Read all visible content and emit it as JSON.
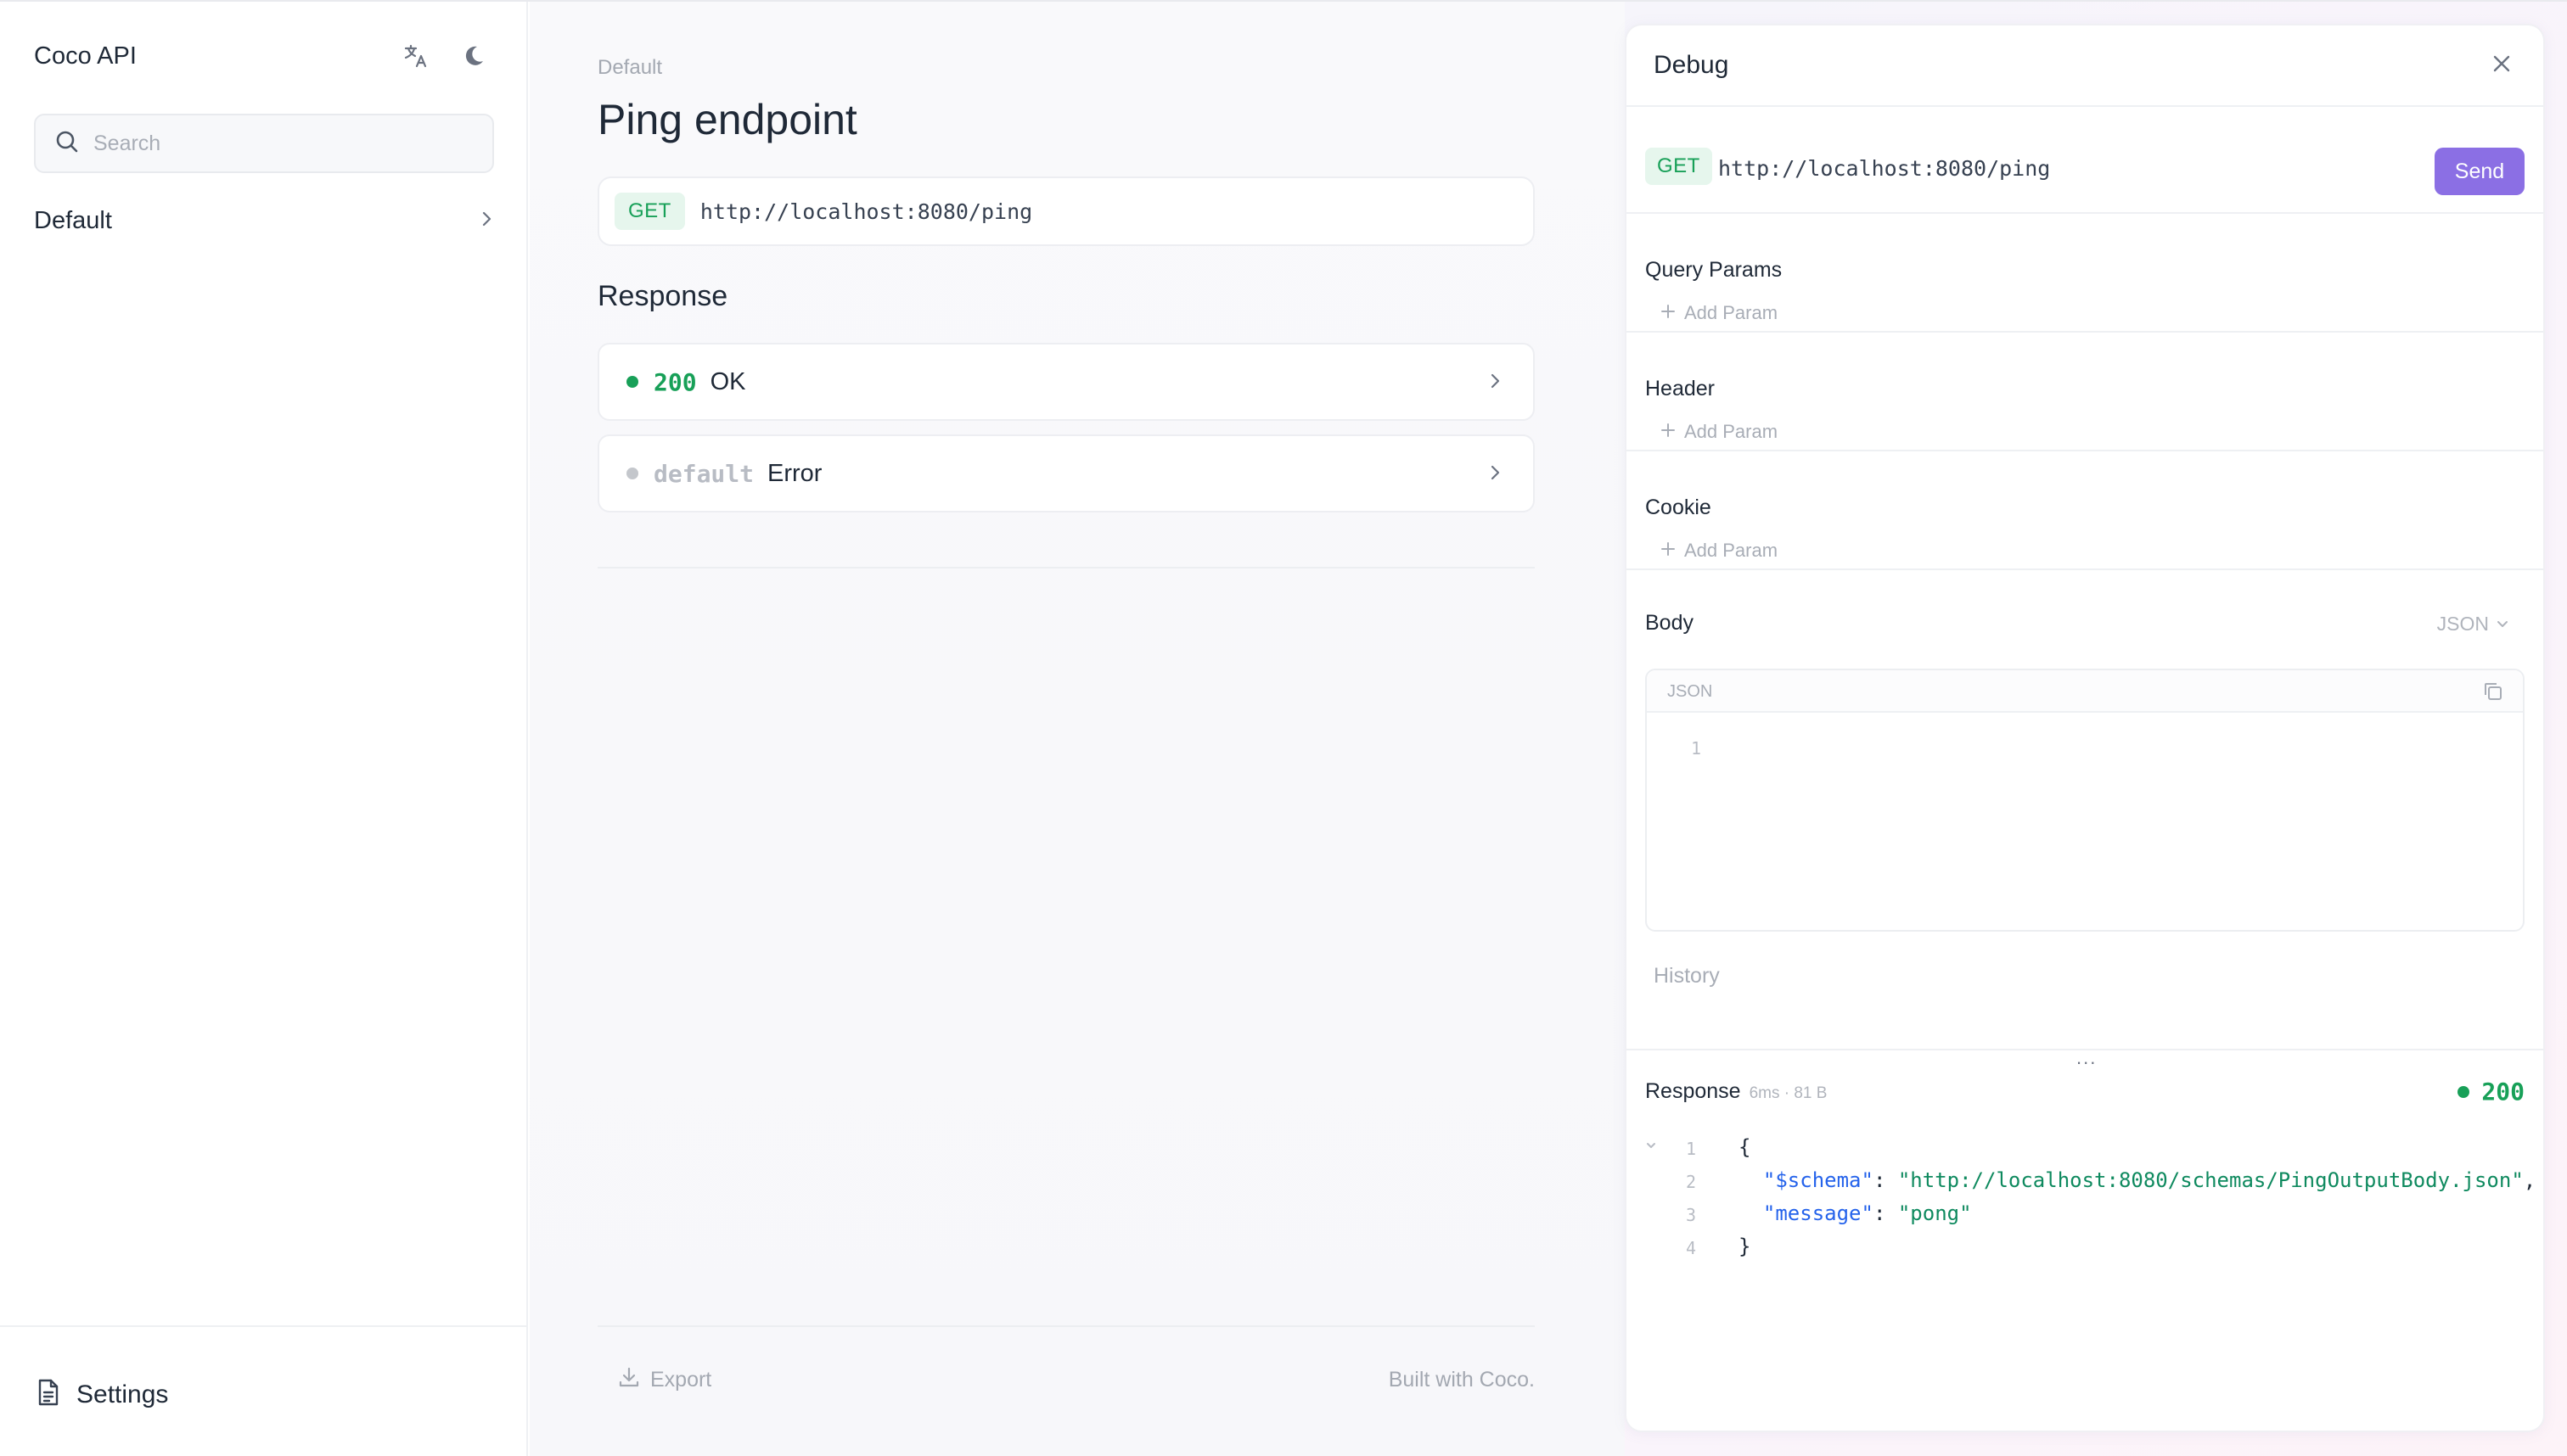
{
  "app": {
    "title": "Coco API"
  },
  "sidebar": {
    "search_placeholder": "Search",
    "items": [
      {
        "label": "Default"
      }
    ],
    "footer": {
      "settings_label": "Settings"
    },
    "icons": {
      "translate": "translate-icon",
      "theme": "moon-icon",
      "search": "search-icon",
      "settings": "document-icon",
      "chevron": "chevron-right-icon"
    }
  },
  "main": {
    "breadcrumb": "Default",
    "title": "Ping endpoint",
    "endpoint": {
      "method": "GET",
      "url": "http://localhost:8080/ping"
    },
    "responses_title": "Response",
    "responses": [
      {
        "code": "200",
        "text": "OK",
        "color": "#18a058",
        "dot": "#18a058"
      },
      {
        "code": "default",
        "text": "Error",
        "color": "#b8bcc4",
        "dot": "#c4c7cc"
      }
    ],
    "footer": {
      "export_label": "Export",
      "built_with": "Built with Coco."
    }
  },
  "debug": {
    "title": "Debug",
    "request": {
      "method": "GET",
      "url": "http://localhost:8080/ping",
      "send_label": "Send"
    },
    "sections": [
      {
        "title": "Query Params",
        "add_label": "Add Param"
      },
      {
        "title": "Header",
        "add_label": "Add Param"
      },
      {
        "title": "Cookie",
        "add_label": "Add Param"
      }
    ],
    "body": {
      "title": "Body",
      "type_label": "JSON",
      "editor_label": "JSON",
      "line_numbers": [
        "1"
      ]
    },
    "history_label": "History",
    "resize_handle": "...",
    "response": {
      "title": "Response",
      "meta": "6ms · 81 B",
      "status_code": "200",
      "status_color": "#18a058",
      "lines": [
        {
          "num": "1",
          "parts": {
            "p1": "{"
          }
        },
        {
          "num": "2",
          "parts": {
            "indent": "  ",
            "key": "\"$schema\"",
            "sep": ": ",
            "value": "\"http://localhost:8080/schemas/PingOutputBody.json\"",
            "end": ","
          }
        },
        {
          "num": "3",
          "parts": {
            "indent": "  ",
            "key": "\"message\"",
            "sep": ": ",
            "value": "\"pong\"",
            "end": ""
          }
        },
        {
          "num": "4",
          "parts": {
            "p1": "}"
          }
        }
      ]
    }
  },
  "colors": {
    "accent": "#8b6fe4",
    "success": "#18a058",
    "get_badge_bg": "#e6f6ed"
  }
}
